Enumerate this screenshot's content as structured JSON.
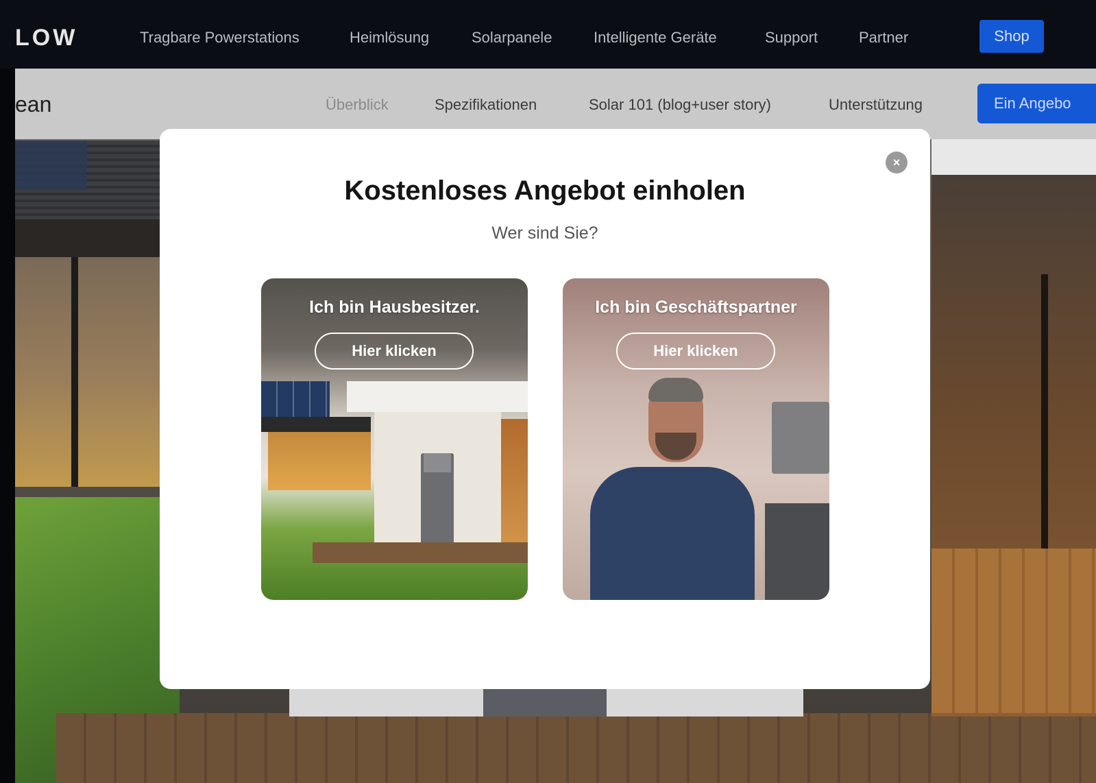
{
  "topnav": {
    "logo": "LOW",
    "links": [
      "Tragbare Powerstations",
      "Heimlösung",
      "Solarpanele",
      "Intelligente Geräte",
      "Support",
      "Partner"
    ],
    "shop_label": "Shop"
  },
  "subnav": {
    "title": "ean",
    "links": [
      "Überblick",
      "Spezifikationen",
      "Solar 101 (blog+user story)",
      "Unterstützung"
    ],
    "offer_label": "Ein Angebo"
  },
  "modal": {
    "title": "Kostenloses Angebot einholen",
    "subtitle": "Wer sind Sie?",
    "close_symbol": "×",
    "cards": [
      {
        "label": "Ich bin Hausbesitzer.",
        "button": "Hier klicken"
      },
      {
        "label": "Ich bin Geschäftspartner",
        "button": "Hier klicken"
      }
    ]
  },
  "colors": {
    "accent": "#1558d6",
    "nav_bg": "#0a0d13",
    "modal_bg": "#ffffff"
  }
}
